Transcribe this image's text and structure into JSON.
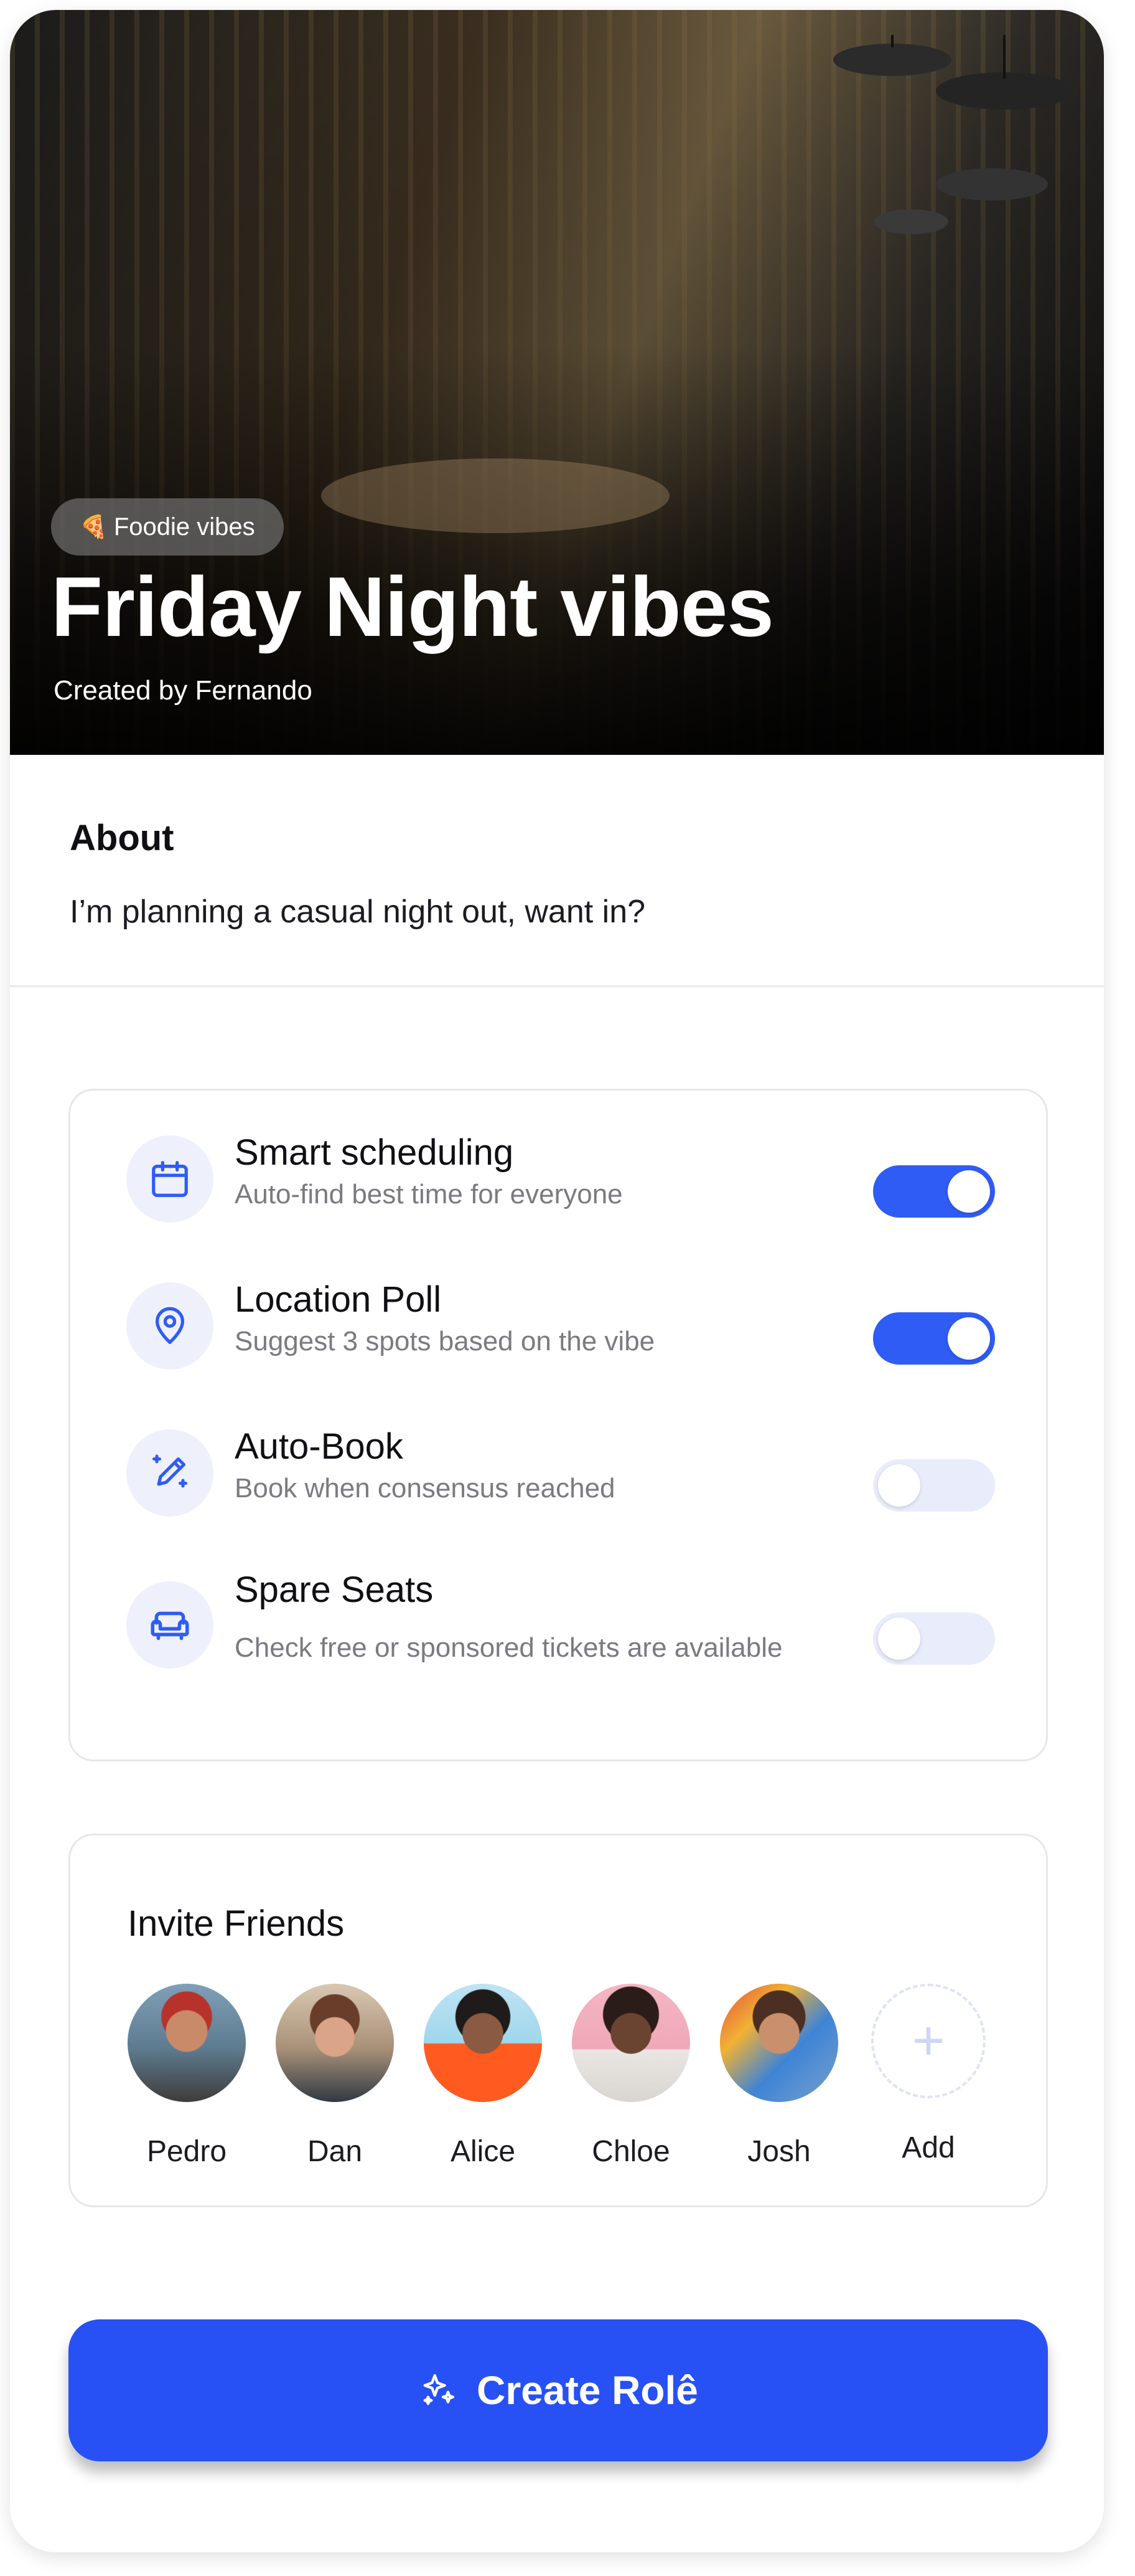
{
  "header": {
    "tag_emoji": "🍕",
    "tag": "Foodie vibes",
    "title": "Friday Night vibes",
    "created_by": "Created by Fernando"
  },
  "about": {
    "heading": "About",
    "text": "I’m planning a casual night out, want in?"
  },
  "features": [
    {
      "title": "Smart scheduling",
      "desc": "Auto-find best time for everyone",
      "icon": "calendar-icon",
      "enabled": true
    },
    {
      "title": "Location Poll",
      "desc": "Suggest 3 spots based on the vibe",
      "icon": "location-pin-icon",
      "enabled": true
    },
    {
      "title": "Auto-Book",
      "desc": "Book when consensus reached",
      "icon": "magic-pencil-icon",
      "enabled": false
    },
    {
      "title": "Spare Seats",
      "desc": "Check free or sponsored tickets are available",
      "icon": "sofa-icon",
      "enabled": false
    }
  ],
  "friends": {
    "heading": "Invite Friends",
    "people": [
      "Pedro",
      "Dan",
      "Alice",
      "Chloe",
      "Josh"
    ],
    "add_label": "Add"
  },
  "cta": {
    "label": "Create Rolê",
    "icon": "sparkles-icon"
  },
  "colors": {
    "accent": "#2F5CF4",
    "cta": "#2751F5",
    "toggle_off": "#E8ECFB",
    "icon_bg": "#EEF0FB"
  }
}
